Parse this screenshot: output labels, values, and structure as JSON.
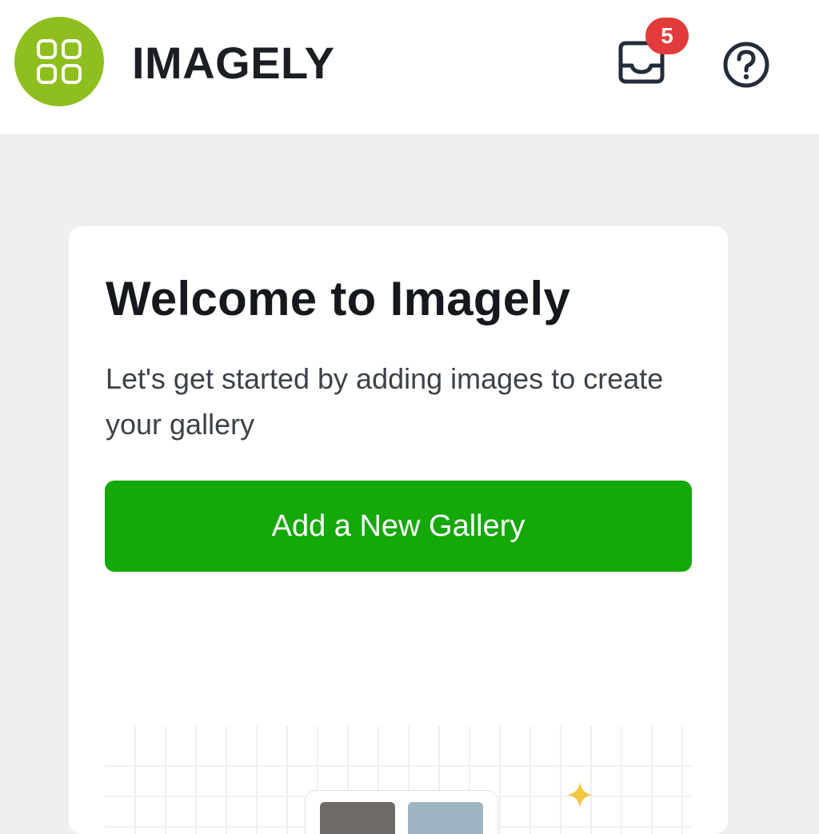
{
  "header": {
    "brand": "IMAGELY",
    "notification_count": "5",
    "logo_icon": "grid-icon",
    "inbox_icon": "inbox-icon",
    "help_icon": "help-circle-icon"
  },
  "welcome": {
    "title": "Welcome to Imagely",
    "subtitle": "Let's get started by adding images to create your gallery",
    "cta_label": "Add a New Gallery"
  },
  "colors": {
    "brand": "#8fbf1f",
    "cta": "#15a80a",
    "badge": "#e33b3b",
    "background": "#efefef"
  }
}
